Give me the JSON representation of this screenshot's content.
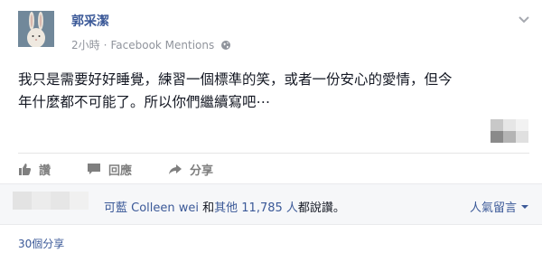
{
  "post": {
    "author": "郭采潔",
    "time": "2小時",
    "separator": "·",
    "source": "Facebook Mentions",
    "privacy_icon": "globe-icon",
    "text_lines": [
      "我只是需要好好睡覺，練習一個標準的笑，或者一份安心的愛情，但今",
      "年什麼都不可能了。所以你們繼續寫吧⋯"
    ]
  },
  "actions": {
    "like_label": "讚",
    "comment_label": "回應",
    "share_label": "分享"
  },
  "likes": {
    "prefix": "可藍 Colleen wei",
    "connector": " 和",
    "others": "其他 11,785 人",
    "suffix": "都說讚。"
  },
  "sort": {
    "label": "人氣留言"
  },
  "shares": {
    "label": "30個分享"
  },
  "colors": {
    "link": "#3b5998",
    "text": "#141823",
    "muted": "#90949c",
    "bar_bg": "#f6f7f9"
  }
}
